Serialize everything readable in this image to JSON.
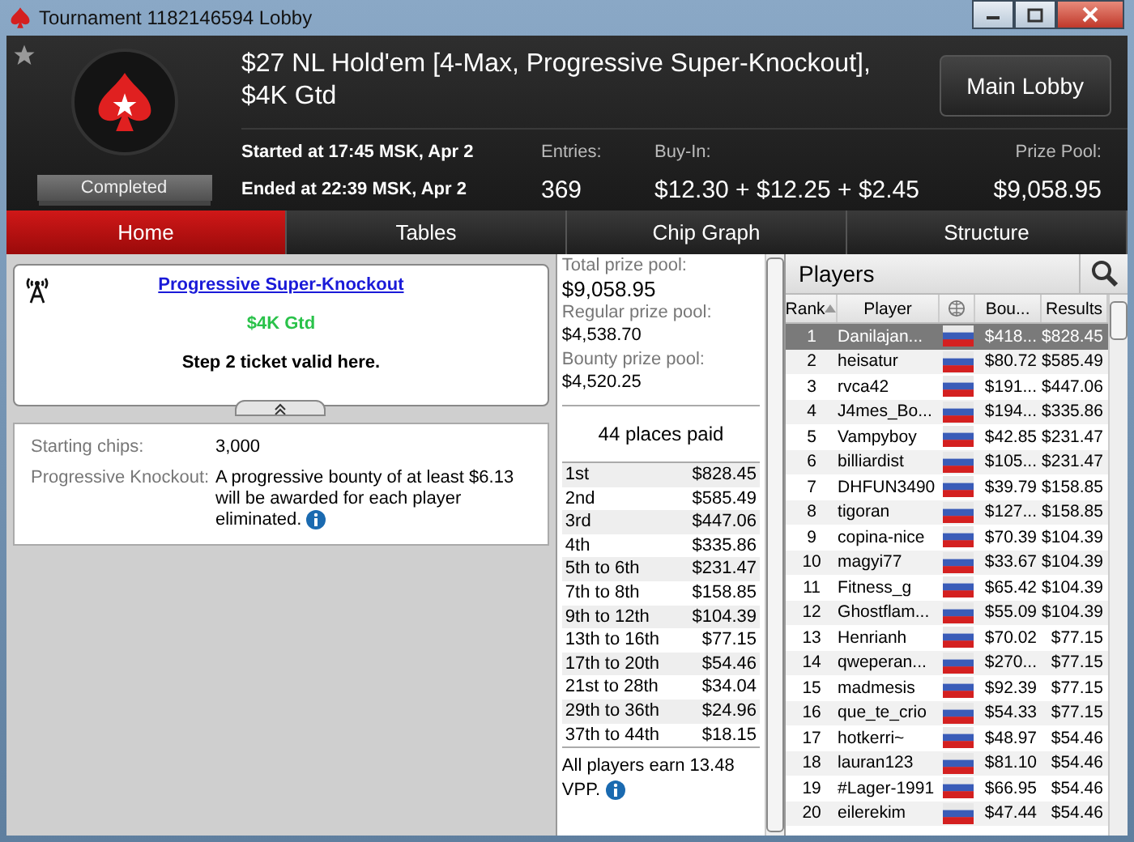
{
  "window": {
    "title": "Tournament 1182146594 Lobby"
  },
  "header": {
    "title": "$27 NL Hold'em [4-Max, Progressive Super-Knockout], $4K Gtd",
    "status": "Completed",
    "started": "Started at 17:45 MSK, Apr 2",
    "ended": "Ended at 22:39 MSK, Apr 2",
    "entries_label": "Entries:",
    "entries": "369",
    "buyin_label": "Buy-In:",
    "buyin": "$12.30 + $12.25 + $2.45",
    "prize_label": "Prize Pool:",
    "prize": "$9,058.95",
    "button": "Main Lobby"
  },
  "tabs": [
    {
      "label": "Home",
      "selected": true
    },
    {
      "label": "Tables",
      "selected": false
    },
    {
      "label": "Chip Graph",
      "selected": false
    },
    {
      "label": "Structure",
      "selected": false
    }
  ],
  "promo": {
    "link": "Progressive Super-Knockout",
    "guarantee": "$4K Gtd",
    "note": "Step 2 ticket valid here."
  },
  "details": [
    {
      "label": "Starting chips:",
      "value": "3,000",
      "info": false
    },
    {
      "label": "Progressive Knockout:",
      "value": "A progressive bounty of at least $6.13 will be awarded for each player eliminated.",
      "info": true
    }
  ],
  "prize_pool": {
    "pools": [
      {
        "label": "Total prize pool:",
        "value": "$9,058.95"
      },
      {
        "label": "Regular prize pool:",
        "value": "$4,538.70"
      },
      {
        "label": "Bounty prize pool:",
        "value": "$4,520.25"
      }
    ],
    "places_paid": "44 places paid",
    "payouts": [
      [
        "1st",
        "$828.45"
      ],
      [
        "2nd",
        "$585.49"
      ],
      [
        "3rd",
        "$447.06"
      ],
      [
        "4th",
        "$335.86"
      ],
      [
        "5th to 6th",
        "$231.47"
      ],
      [
        "7th to 8th",
        "$158.85"
      ],
      [
        "9th to 12th",
        "$104.39"
      ],
      [
        "13th to 16th",
        "$77.15"
      ],
      [
        "17th to 20th",
        "$54.46"
      ],
      [
        "21st to 28th",
        "$34.04"
      ],
      [
        "29th to 36th",
        "$24.96"
      ],
      [
        "37th to 44th",
        "$18.15"
      ]
    ],
    "vpp": "All players earn 13.48 VPP."
  },
  "players": {
    "title": "Players",
    "columns": [
      "Rank",
      "Player",
      "Bou...",
      "Results"
    ],
    "rows": [
      {
        "rank": "1",
        "name": "Danilajan...",
        "bounty": "$418...",
        "result": "$828.45",
        "selected": true
      },
      {
        "rank": "2",
        "name": "heisatur",
        "bounty": "$80.72",
        "result": "$585.49",
        "selected": false
      },
      {
        "rank": "3",
        "name": "rvca42",
        "bounty": "$191...",
        "result": "$447.06",
        "selected": false
      },
      {
        "rank": "4",
        "name": "J4mes_Bo...",
        "bounty": "$194...",
        "result": "$335.86",
        "selected": false
      },
      {
        "rank": "5",
        "name": "Vampyboy",
        "bounty": "$42.85",
        "result": "$231.47",
        "selected": false
      },
      {
        "rank": "6",
        "name": "billiardist",
        "bounty": "$105...",
        "result": "$231.47",
        "selected": false
      },
      {
        "rank": "7",
        "name": "DHFUN3490",
        "bounty": "$39.79",
        "result": "$158.85",
        "selected": false
      },
      {
        "rank": "8",
        "name": "tigoran",
        "bounty": "$127...",
        "result": "$158.85",
        "selected": false
      },
      {
        "rank": "9",
        "name": "copina-nice",
        "bounty": "$70.39",
        "result": "$104.39",
        "selected": false
      },
      {
        "rank": "10",
        "name": "magyi77",
        "bounty": "$33.67",
        "result": "$104.39",
        "selected": false
      },
      {
        "rank": "11",
        "name": "Fitness_g",
        "bounty": "$65.42",
        "result": "$104.39",
        "selected": false
      },
      {
        "rank": "12",
        "name": "Ghostflam...",
        "bounty": "$55.09",
        "result": "$104.39",
        "selected": false
      },
      {
        "rank": "13",
        "name": "Henrianh",
        "bounty": "$70.02",
        "result": "$77.15",
        "selected": false
      },
      {
        "rank": "14",
        "name": "qweperan...",
        "bounty": "$270...",
        "result": "$77.15",
        "selected": false
      },
      {
        "rank": "15",
        "name": "madmesis",
        "bounty": "$92.39",
        "result": "$77.15",
        "selected": false
      },
      {
        "rank": "16",
        "name": "que_te_crio",
        "bounty": "$54.33",
        "result": "$77.15",
        "selected": false
      },
      {
        "rank": "17",
        "name": "hotkerri~",
        "bounty": "$48.97",
        "result": "$54.46",
        "selected": false
      },
      {
        "rank": "18",
        "name": "lauran123",
        "bounty": "$81.10",
        "result": "$54.46",
        "selected": false
      },
      {
        "rank": "19",
        "name": "#Lager-1991",
        "bounty": "$66.95",
        "result": "$54.46",
        "selected": false
      },
      {
        "rank": "20",
        "name": "eilerekim",
        "bounty": "$47.44",
        "result": "$54.46",
        "selected": false
      }
    ]
  }
}
